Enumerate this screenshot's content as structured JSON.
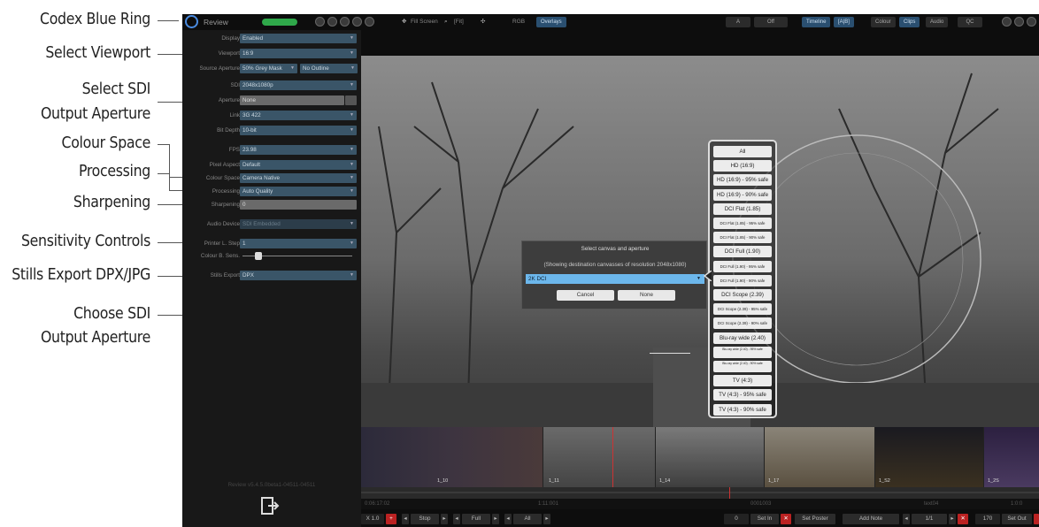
{
  "callouts": [
    {
      "text": "Codex Blue Ring"
    },
    {
      "text": "Select Viewport"
    },
    {
      "text": "Select SDI\nOutput Aperture"
    },
    {
      "text": "Colour Space"
    },
    {
      "text": "Processing"
    },
    {
      "text": "Sharpening"
    },
    {
      "text": "Sensitivity Controls"
    },
    {
      "text": "Stills Export DPX/JPG"
    },
    {
      "text": "Choose SDI\nOutput Aperture"
    }
  ],
  "topbar": {
    "title": "Review",
    "fill_screen": "Fill Screen",
    "fit": "[Fit]",
    "rgb": "RGB",
    "overlays": "Overlays",
    "a": "A",
    "off": "Off",
    "timeline": "Timeline",
    "ab": "[A|B]",
    "colour": "Colour",
    "clips": "Clips",
    "audio": "Audio",
    "qc": "QC"
  },
  "settings": {
    "display": {
      "label": "Display",
      "value": "Enabled"
    },
    "viewport": {
      "label": "Viewport",
      "value": "16:9"
    },
    "source_aperture": {
      "label": "Source Aperture",
      "value": "50% Grey Mask",
      "value2": "No Outline"
    },
    "sdi": {
      "label": "SDI",
      "value": "2048x1080p"
    },
    "aperture": {
      "label": "Aperture",
      "value": "None"
    },
    "link": {
      "label": "Link",
      "value": "3G 422"
    },
    "bit_depth": {
      "label": "Bit Depth",
      "value": "10-bit"
    },
    "fps": {
      "label": "FPS",
      "value": "23.98"
    },
    "pixel_aspect": {
      "label": "Pixel Aspect",
      "value": "Default"
    },
    "colour_space": {
      "label": "Colour Space",
      "value": "Camera Native"
    },
    "processing": {
      "label": "Processing",
      "value": "Auto Quality"
    },
    "sharpening": {
      "label": "Sharpening",
      "value": "0"
    },
    "audio_device": {
      "label": "Audio Device",
      "value": "SDI Embedded"
    },
    "printer_step": {
      "label": "Printer L. Step",
      "value": "1"
    },
    "colour_sens": {
      "label": "Colour B. Sens.",
      "level": 0.12
    },
    "stills_export": {
      "label": "Stills Export",
      "value": "DPX"
    }
  },
  "version": "Review v5.4.5.0beta1-04511-04511",
  "dialog": {
    "title": "Select canvas and aperture",
    "subtitle": "(Showing destination canvasses of resolution 2048x1080)",
    "selected": "2K DCI",
    "cancel": "Cancel",
    "none": "None"
  },
  "apertures": [
    {
      "label": "All",
      "size": "n"
    },
    {
      "label": "HD (16:9)",
      "size": "n"
    },
    {
      "label": "HD (16:9) - 95% safe",
      "size": "n"
    },
    {
      "label": "HD (16:9) - 90% safe",
      "size": "n"
    },
    {
      "label": "DCI Flat (1.85)",
      "size": "n"
    },
    {
      "label": "DCI Flat (1.85) - 95% safe",
      "size": "s"
    },
    {
      "label": "DCI Flat (1.85) - 90% safe",
      "size": "s"
    },
    {
      "label": "DCI Full (1.90)",
      "size": "n"
    },
    {
      "label": "DCI Full (1.90) - 95% safe",
      "size": "s"
    },
    {
      "label": "DCI Full (1.90) - 90% safe",
      "size": "s"
    },
    {
      "label": "DCI Scope (2.39)",
      "size": "n"
    },
    {
      "label": "DCI Scope (2.39) - 95% safe",
      "size": "s"
    },
    {
      "label": "DCI Scope (2.39) - 90% safe",
      "size": "s"
    },
    {
      "label": "Blu-ray wide (2.40)",
      "size": "n"
    },
    {
      "label": "Blu-ray wide (2.40) - 95% safe",
      "size": "t"
    },
    {
      "label": "Blu-ray wide (2.40) - 90% safe",
      "size": "t"
    },
    {
      "label": "TV (4:3)",
      "size": "n"
    },
    {
      "label": "TV (4:3) - 95% safe",
      "size": "n"
    },
    {
      "label": "TV (4:3) - 90% safe",
      "size": "n"
    }
  ],
  "clips": [
    "1_10",
    "1_11",
    "1_14",
    "1_17",
    "1_S2",
    "1_2S"
  ],
  "timecodes": [
    "0:06:17:02",
    "1:11:001",
    "0001003",
    "text04",
    "1:0:0"
  ],
  "transport": {
    "speed": "X 1.0",
    "stop": "Stop",
    "full": "Full",
    "all": "All",
    "frame": "0",
    "set_in": "Set In",
    "set_poster": "Set Poster",
    "add_note": "Add Note",
    "page": "1/1",
    "duration": "170",
    "set_out": "Set Out"
  },
  "colors": {
    "accent": "#4a8be0",
    "field": "#3a5568",
    "selection": "#6cb7ec",
    "red": "#b22222"
  }
}
